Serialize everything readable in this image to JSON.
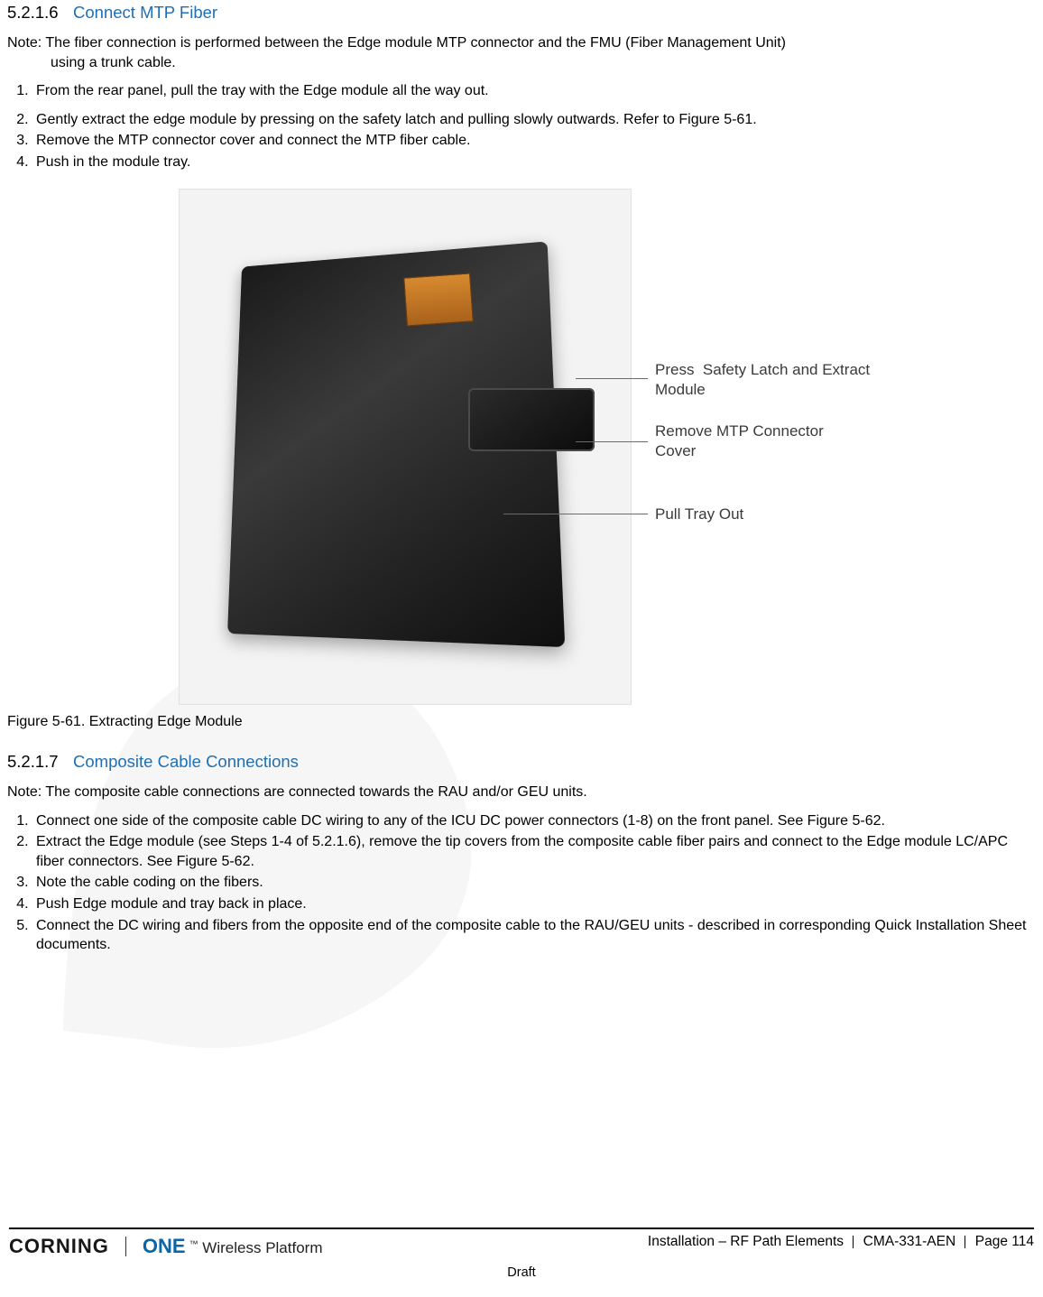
{
  "section1": {
    "number": "5.2.1.6",
    "title": "Connect MTP Fiber",
    "note_label": "Note:",
    "note_text": " The fiber connection is performed between the Edge module MTP connector and the FMU (Fiber Management Unit)",
    "note_cont": "using a trunk cable.",
    "step1": "From the rear panel, pull the tray with the Edge module all the way out.",
    "step2": "Gently extract the edge module by pressing on the safety latch and pulling slowly outwards. Refer to Figure 5-61.",
    "step3": "Remove the MTP connector cover and connect the MTP fiber cable.",
    "step4": "Push in the module tray."
  },
  "figure1": {
    "callout1": "Press  Safety Latch and Extract\nModule",
    "callout2": "Remove MTP Connector\nCover",
    "callout3": "Pull Tray Out",
    "caption": "Figure 5-61. Extracting Edge Module"
  },
  "section2": {
    "number": "5.2.1.7",
    "title": "Composite Cable Connections",
    "note_label": "Note:",
    "note_text": " The composite cable connections are connected towards the RAU and/or GEU units.",
    "step1": "Connect one side of the composite cable DC wiring to any of the ICU DC power connectors (1-8) on the front panel. See Figure 5-62.",
    "step2": "Extract the Edge module (see Steps 1-4 of 5.2.1.6), remove the   tip covers from the composite cable fiber pairs and connect to the Edge module LC/APC   fiber connectors. See Figure 5-62.",
    "step3": "Note the cable coding on the fibers.",
    "step4": "Push Edge module and tray back in place.",
    "step5": "Connect the DC wiring and fibers from the opposite end of the composite cable to the RAU/GEU units - described in corresponding Quick Installation Sheet documents."
  },
  "footer": {
    "brand": "CORNING",
    "sub_num": "ONE",
    "sub_tm": "™",
    "sub_rest": " Wireless Platform",
    "right_a": "Installation – RF Path Elements",
    "right_b": "CMA-331-AEN",
    "right_c": "Page 114",
    "draft": "Draft"
  }
}
